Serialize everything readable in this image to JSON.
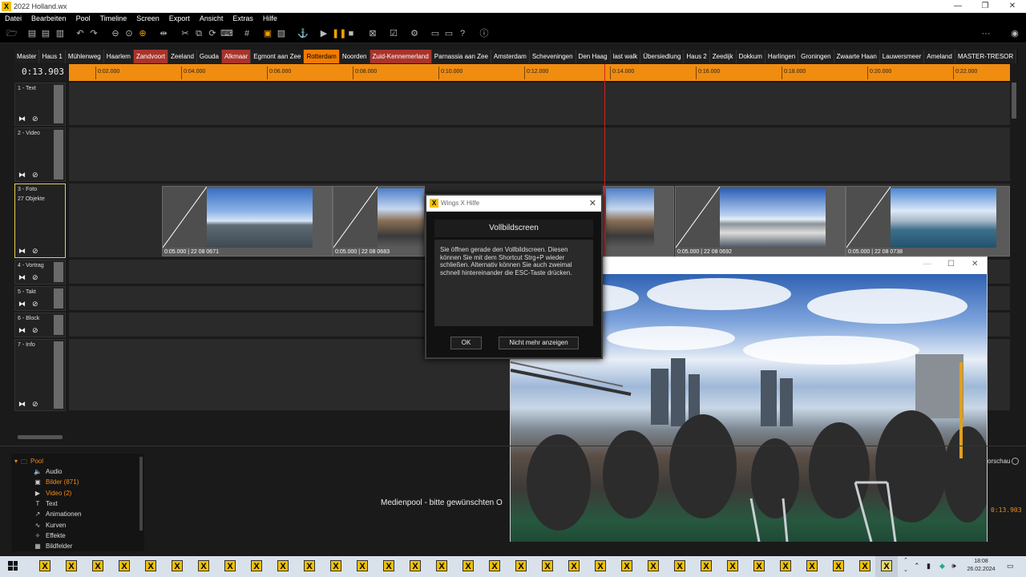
{
  "window": {
    "title": "2022 Holland.wx",
    "min": "—",
    "max": "❐",
    "close": "✕"
  },
  "menu": [
    "Datei",
    "Bearbeiten",
    "Pool",
    "Timeline",
    "Screen",
    "Export",
    "Ansicht",
    "Extras",
    "Hilfe"
  ],
  "toolbar": {
    "more": "···"
  },
  "tabs": [
    {
      "label": "Master",
      "style": "normal"
    },
    {
      "label": "Haus 1",
      "style": "normal"
    },
    {
      "label": "Mühlenweg",
      "style": "normal"
    },
    {
      "label": "Haarlem",
      "style": "normal"
    },
    {
      "label": "Zandvoort",
      "style": "red"
    },
    {
      "label": "Zeeland",
      "style": "normal"
    },
    {
      "label": "Gouda",
      "style": "normal"
    },
    {
      "label": "Alkmaar",
      "style": "red"
    },
    {
      "label": "Egmont aan Zee",
      "style": "normal"
    },
    {
      "label": "Rotterdam",
      "style": "orange"
    },
    {
      "label": "Noorden",
      "style": "normal"
    },
    {
      "label": "Zuid-Kennemerland",
      "style": "red"
    },
    {
      "label": "Parnassia aan Zee",
      "style": "normal"
    },
    {
      "label": "Amsterdam",
      "style": "normal"
    },
    {
      "label": "Scheveningen",
      "style": "normal"
    },
    {
      "label": "Den Haag",
      "style": "normal"
    },
    {
      "label": "last walk",
      "style": "normal"
    },
    {
      "label": "Übersiedlung",
      "style": "normal"
    },
    {
      "label": "Haus 2",
      "style": "normal"
    },
    {
      "label": "Zeedijk",
      "style": "normal"
    },
    {
      "label": "Dokkum",
      "style": "normal"
    },
    {
      "label": "Harlingen",
      "style": "normal"
    },
    {
      "label": "Groningen",
      "style": "normal"
    },
    {
      "label": "Zwaarte Haan",
      "style": "normal"
    },
    {
      "label": "Lauwersmeer",
      "style": "normal"
    },
    {
      "label": "Ameland",
      "style": "normal"
    },
    {
      "label": "MASTER-TRESOR",
      "style": "normal"
    }
  ],
  "timeline": {
    "timecode": "0:13.903",
    "ticks": [
      "0:02.000",
      "0:04.000",
      "0:06.000",
      "0:08.000",
      "0:10.000",
      "0:12.000",
      "0:14.000",
      "0:16.000",
      "0:18.000",
      "0:20.000",
      "0:22.000"
    ]
  },
  "tracks": [
    {
      "name": "1 - Text",
      "sub": ""
    },
    {
      "name": "2 - Video",
      "sub": ""
    },
    {
      "name": "3 - Foto",
      "sub": "27 Objekte"
    },
    {
      "name": "4 - Vortrag",
      "sub": ""
    },
    {
      "name": "5 - Takt",
      "sub": ""
    },
    {
      "name": "6 - Block",
      "sub": ""
    },
    {
      "name": "7 - Info",
      "sub": ""
    }
  ],
  "track_icons": {
    "play": "⧓",
    "mute": "⊘"
  },
  "clips": [
    {
      "label": "0:05.000 | 22 08 0671"
    },
    {
      "label": "0:05.000 | 22 08 0683"
    },
    {
      "label": "0:05.000 | 22 08 0692"
    },
    {
      "label": "0:05.000 | 22 08 0738"
    }
  ],
  "dialog": {
    "title": "Wings X Hilfe",
    "heading": "Vollbildscreen",
    "body": "Sie öffnen gerade den Vollbildscreen. Diesen können Sie mit dem Shortcut Strg+P wieder schließen. Alternativ können Sie auch zweimal schnell hintereinander die ESC-Taste drücken.",
    "ok": "OK",
    "dont_show": "Nicht mehr anzeigen"
  },
  "preview": {
    "min": "—",
    "max": "☐",
    "close": "✕"
  },
  "pool": {
    "root": "Pool",
    "items": [
      {
        "label": "Audio",
        "icon": "🔈",
        "style": "normal"
      },
      {
        "label": "Bilder (871)",
        "icon": "▣",
        "style": "orange"
      },
      {
        "label": "Video (2)",
        "icon": "▶",
        "style": "orange"
      },
      {
        "label": "Text",
        "icon": "T",
        "style": "normal"
      },
      {
        "label": "Animationen",
        "icon": "↗",
        "style": "normal"
      },
      {
        "label": "Kurven",
        "icon": "∿",
        "style": "normal"
      },
      {
        "label": "Effekte",
        "icon": "✧",
        "style": "normal"
      },
      {
        "label": "Bildfelder",
        "icon": "▦",
        "style": "normal"
      }
    ],
    "message": "Medienpool - bitte gewünschten O",
    "vorschau": "orschau",
    "timecode": "0:13.903"
  },
  "taskbar": {
    "time": "18:08",
    "date": "26.02.2024",
    "app_glyph": "X"
  }
}
